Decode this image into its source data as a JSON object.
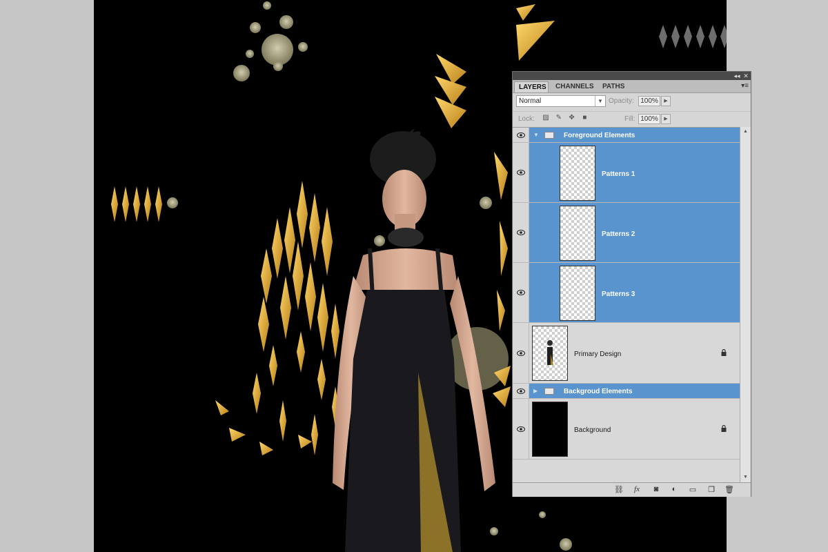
{
  "panel": {
    "tabs": [
      {
        "label": "LAYERS",
        "active": true
      },
      {
        "label": "CHANNELS",
        "active": false
      },
      {
        "label": "PATHS",
        "active": false
      }
    ],
    "blend_mode": "Normal",
    "opacity_label": "Opacity:",
    "opacity_value": "100%",
    "lock_label": "Lock:",
    "fill_label": "Fill:",
    "fill_value": "100%",
    "layers": [
      {
        "name": "Foreground Elements",
        "type": "group",
        "selected": true
      },
      {
        "name": "Patterns 1",
        "type": "layer",
        "selected": true
      },
      {
        "name": "Patterns 2",
        "type": "layer",
        "selected": true
      },
      {
        "name": "Patterns 3",
        "type": "layer",
        "selected": true
      },
      {
        "name": "Primary Design",
        "type": "layer",
        "selected": false,
        "locked": true
      },
      {
        "name": "Backgroud Elements",
        "type": "group",
        "selected": true
      },
      {
        "name": "Background",
        "type": "layer",
        "selected": false,
        "locked": true
      }
    ],
    "footer_icons": [
      "link-icon",
      "fx-icon",
      "mask-icon",
      "adjustment-icon",
      "folder-icon",
      "new-layer-icon",
      "trash-icon"
    ],
    "footer_fx_label": "fx"
  },
  "colors": {
    "selection": "#5a94cf",
    "gold": "#f2b632",
    "canvas": "#000000"
  }
}
